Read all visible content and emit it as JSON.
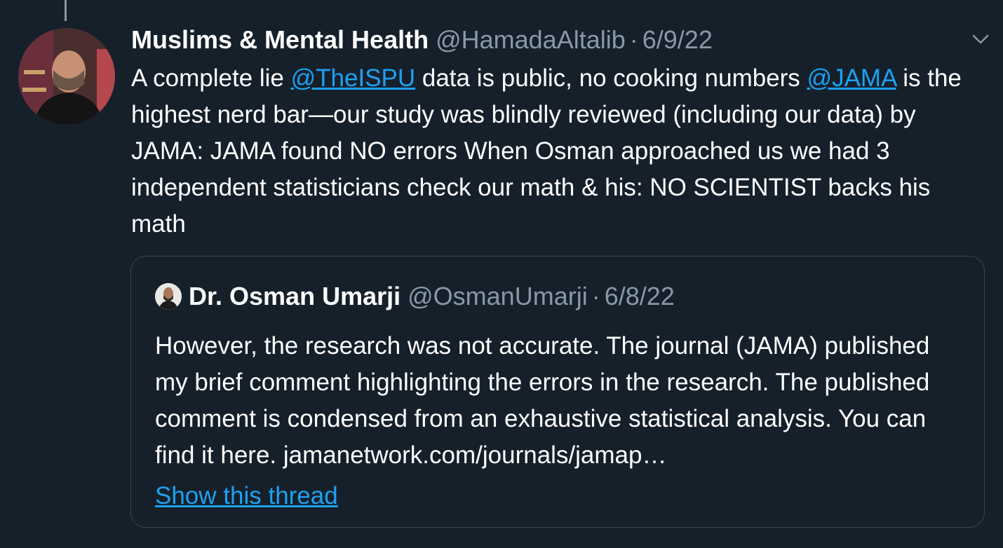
{
  "tweet": {
    "display_name": "Muslims & Mental Health",
    "handle": "@HamadaAltalib",
    "separator": "·",
    "date": "6/9/22",
    "text_parts": {
      "p1": "A complete lie ",
      "mention1": "@TheISPU",
      "p2": " data is public, no cooking numbers ",
      "mention2": "@JAMA",
      "p3": " is the highest nerd bar—our study was blindly reviewed (including our data) by JAMA: JAMA found NO errors When Osman approached us we had 3 independent statisticians check our math & his: NO SCIENTIST backs his math"
    },
    "more_icon": "chevron-down-icon"
  },
  "quoted_tweet": {
    "display_name": "Dr. Osman Umarji",
    "handle": "@OsmanUmarji",
    "separator": "·",
    "date": "6/8/22",
    "text": "However, the research was not accurate. The journal (JAMA) published my brief comment highlighting the errors in the research. The published comment is condensed from an exhaustive statistical analysis. You can find it here. jamanetwork.com/journals/jamap…",
    "show_thread_label": "Show this thread"
  },
  "colors": {
    "background": "#15202b",
    "text": "#ffffff",
    "secondary": "#8899a6",
    "link": "#1da1f2",
    "border": "#38444d"
  }
}
